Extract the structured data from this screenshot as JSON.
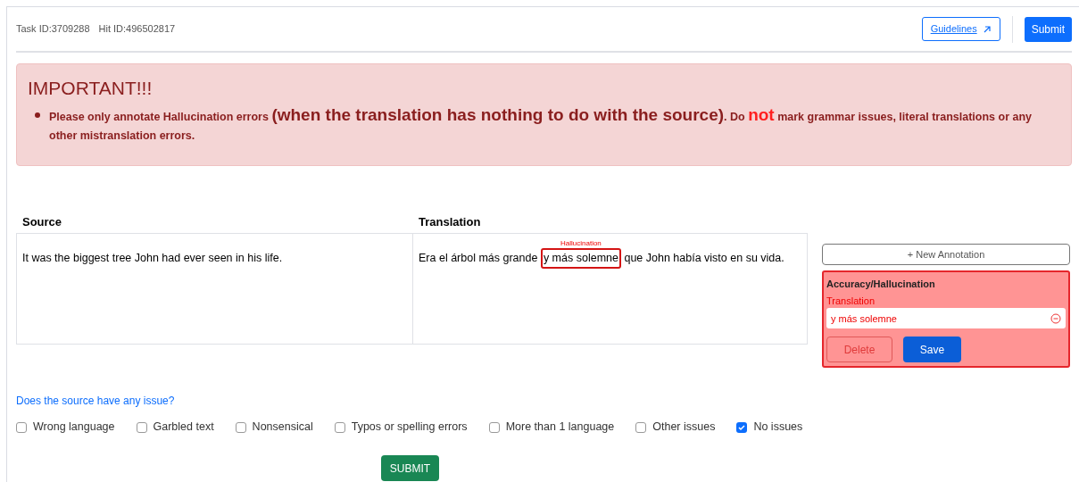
{
  "header": {
    "task_id": "Task ID:3709288",
    "hit_id": "Hit ID:496502817",
    "guidelines_link": "Guidelines",
    "submit_button": "Submit"
  },
  "alert": {
    "title": "IMPORTANT!!!",
    "items": [
      {
        "segments": [
          {
            "kind": "normal",
            "text": "Please only annotate Hallucination errors "
          },
          {
            "kind": "large",
            "text": "(when the translation has nothing to do with the source)"
          },
          {
            "kind": "normal",
            "text": ". Do "
          },
          {
            "kind": "accent",
            "text": "not"
          },
          {
            "kind": "normal",
            "text": " mark grammar issues, literal translations or any other mistranslation errors."
          }
        ]
      }
    ]
  },
  "table": {
    "columns": [
      "Source",
      "Translation"
    ],
    "source": "It was the biggest tree John had ever seen in his life.",
    "translation": {
      "before": "Era el árbol más grande ",
      "highlight": "y más solemne",
      "highlight_label": "Hallucination",
      "after": " que John había visto en su vida."
    }
  },
  "annotations": {
    "new_button": "+ New Annotation",
    "card": {
      "category": "Accuracy/Hallucination",
      "field_label": "Translation",
      "value": "y más solemne",
      "delete_button": "Delete",
      "save_button": "Save"
    }
  },
  "question": "Does the source have any issue?",
  "issues": [
    {
      "label": "Wrong language",
      "checked": false
    },
    {
      "label": "Garbled text",
      "checked": false
    },
    {
      "label": "Nonsensical",
      "checked": false
    },
    {
      "label": "Typos or spelling errors",
      "checked": false
    },
    {
      "label": "More than 1 language",
      "checked": false
    },
    {
      "label": "Other issues",
      "checked": false
    },
    {
      "label": "No issues",
      "checked": true
    }
  ],
  "submit": "SUBMIT"
}
